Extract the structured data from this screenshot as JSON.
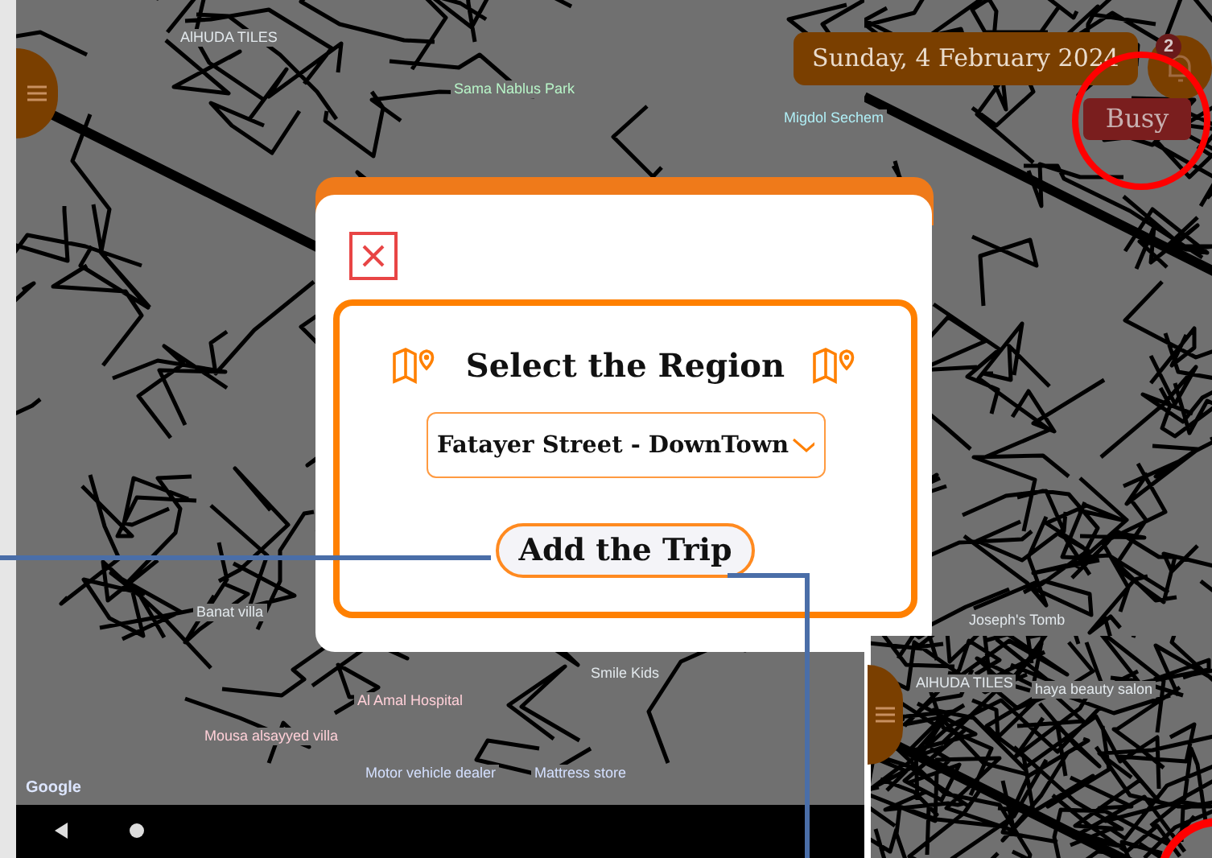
{
  "screen": {
    "date": "Sunday, 4 February 2024",
    "notification_count": "2",
    "status_button": "Busy"
  },
  "map": {
    "labels": [
      {
        "text": "AlHUDA TILES",
        "kind": "grey"
      },
      {
        "text": "Sama Nablus Park",
        "kind": "green"
      },
      {
        "text": "Migdol Sechem",
        "kind": "teal"
      },
      {
        "text": "Banat villa",
        "kind": "grey"
      },
      {
        "text": "Smile Kids",
        "kind": "grey"
      },
      {
        "text": "Al Amal Hospital",
        "kind": "red"
      },
      {
        "text": "Mousa alsayyed villa",
        "kind": "red"
      },
      {
        "text": "Motor vehicle dealer",
        "kind": "blue"
      },
      {
        "text": "Mattress store",
        "kind": "blue"
      },
      {
        "text": "Joseph's Tomb",
        "kind": "grey"
      }
    ],
    "attribution": "Google"
  },
  "dialog": {
    "title": "Select the Region",
    "region": "Fatayer Street - DownTown",
    "button": "Add the Trip"
  },
  "inset": {
    "labels": [
      {
        "text": "AlHUDA TILES",
        "kind": "grey"
      },
      {
        "text": "haya beauty salon",
        "kind": "grey"
      }
    ]
  }
}
